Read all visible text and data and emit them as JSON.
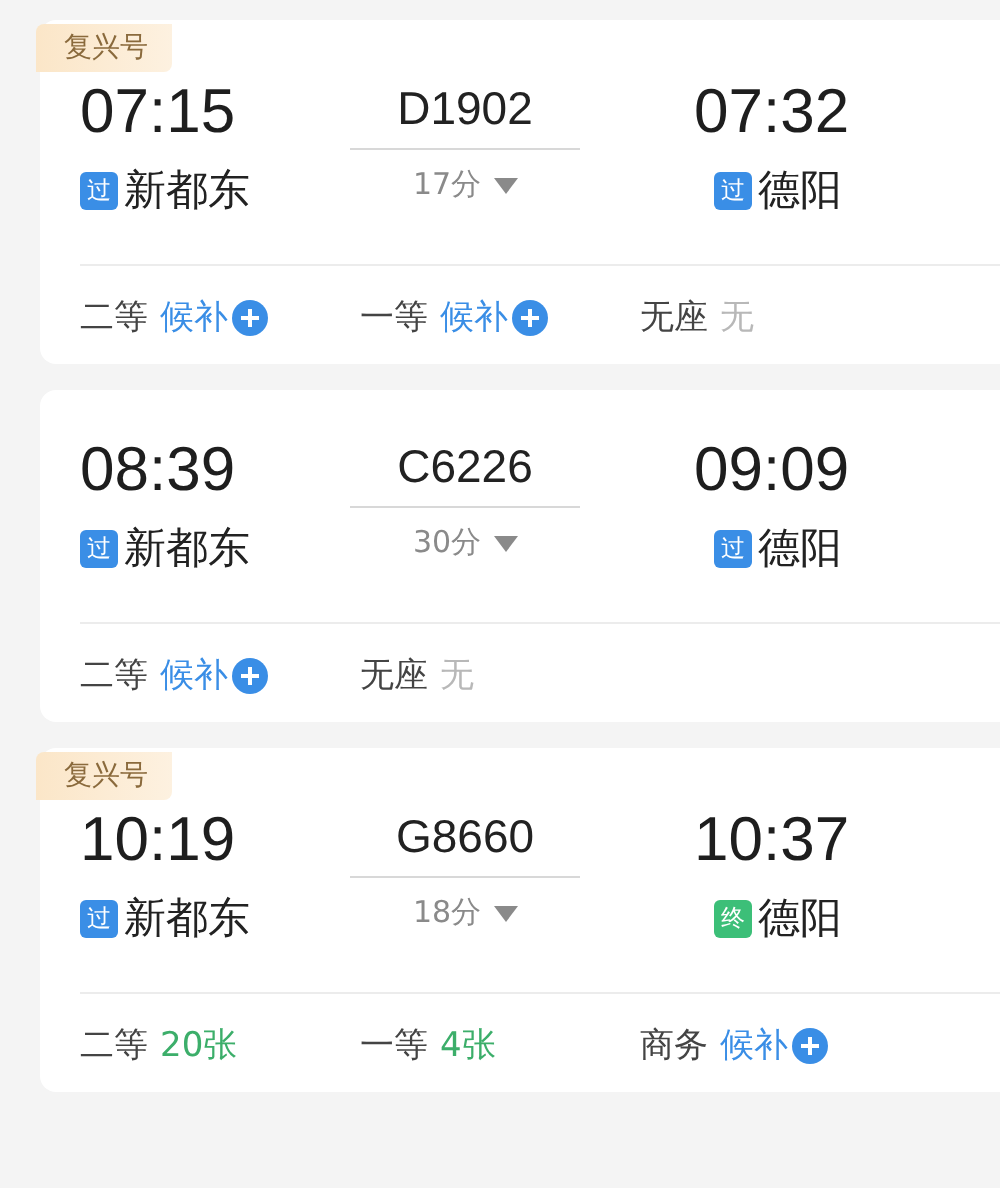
{
  "trains": [
    {
      "tag": "复兴号",
      "depart_time": "07:15",
      "number": "D1902",
      "arrive_time": "07:32",
      "duration": "17分",
      "from": {
        "badge": "过",
        "kind": "pass",
        "name": "新都东"
      },
      "to": {
        "badge": "过",
        "kind": "pass",
        "name": "德阳"
      },
      "seats": [
        {
          "class": "二等",
          "status": "候补",
          "kind": "waitlist"
        },
        {
          "class": "一等",
          "status": "候补",
          "kind": "waitlist"
        },
        {
          "class": "无座",
          "status": "无",
          "kind": "none"
        }
      ]
    },
    {
      "depart_time": "08:39",
      "number": "C6226",
      "arrive_time": "09:09",
      "duration": "30分",
      "from": {
        "badge": "过",
        "kind": "pass",
        "name": "新都东"
      },
      "to": {
        "badge": "过",
        "kind": "pass",
        "name": "德阳"
      },
      "seats": [
        {
          "class": "二等",
          "status": "候补",
          "kind": "waitlist"
        },
        {
          "class": "无座",
          "status": "无",
          "kind": "none"
        }
      ]
    },
    {
      "tag": "复兴号",
      "depart_time": "10:19",
      "number": "G8660",
      "arrive_time": "10:37",
      "duration": "18分",
      "from": {
        "badge": "过",
        "kind": "pass",
        "name": "新都东"
      },
      "to": {
        "badge": "终",
        "kind": "end",
        "name": "德阳"
      },
      "seats": [
        {
          "class": "二等",
          "status": "20张",
          "kind": "available"
        },
        {
          "class": "一等",
          "status": "4张",
          "kind": "available"
        },
        {
          "class": "商务",
          "status": "候补",
          "kind": "waitlist"
        }
      ]
    }
  ]
}
